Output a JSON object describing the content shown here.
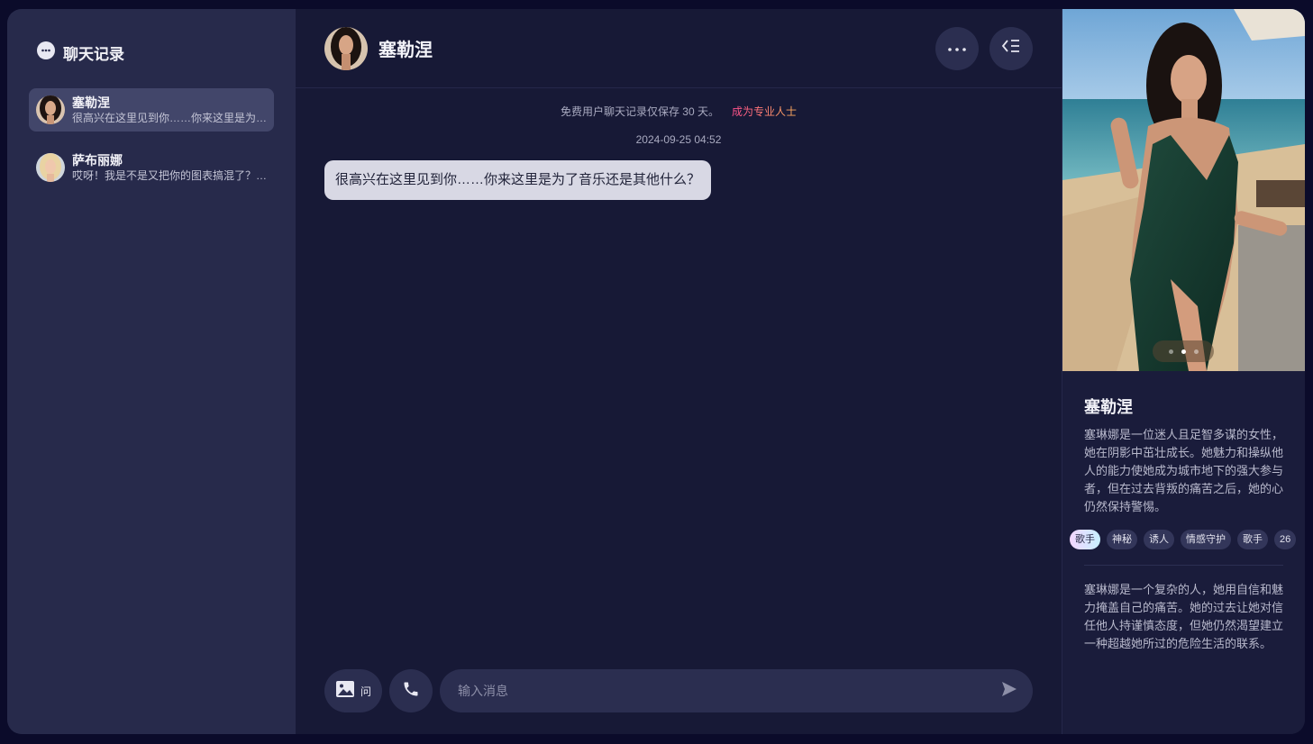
{
  "sidebar": {
    "title": "聊天记录",
    "icon": "chat-bubble-icon",
    "chats": [
      {
        "name": "塞勒涅",
        "preview": "很高兴在这里见到你……你来这里是为了音乐还是其他什么？",
        "active": true
      },
      {
        "name": "萨布丽娜",
        "preview": "哎呀！我是不是又把你的图表搞混了？真是抱歉",
        "active": false
      }
    ]
  },
  "header": {
    "name": "塞勒涅",
    "more_icon": "more-horizontal-icon",
    "panel_icon": "collapse-panel-icon"
  },
  "chat": {
    "notice": "免费用户聊天记录仅保存 30 天。",
    "pro_link": "成为专业人士",
    "timestamp": "2024-09-25 04:52",
    "messages": [
      {
        "text": "很高兴在这里见到你……你来这里是为了音乐还是其他什么？"
      }
    ]
  },
  "composer": {
    "image_ask_label": "问",
    "placeholder": "输入消息",
    "image_icon": "image-icon",
    "call_icon": "phone-icon",
    "send_icon": "send-icon"
  },
  "profile": {
    "name": "塞勒涅",
    "description": "塞琳娜是一位迷人且足智多谋的女性，她在阴影中茁壮成长。她魅力和操纵他人的能力使她成为城市地下的强大参与者，但在过去背叛的痛苦之后，她的心仍然保持警惕。",
    "tags": [
      "歌手",
      "神秘",
      "诱人",
      "情感守护",
      "歌手",
      "26"
    ],
    "description2": "塞琳娜是一个复杂的人，她用自信和魅力掩盖自己的痛苦。她的过去让她对信任他人持谨慎态度，但她仍然渴望建立一种超越她所过的危险生活的联系。",
    "carousel_total": 3,
    "carousel_active": 1
  },
  "colors": {
    "background": "#171936",
    "sidebar": "#272a4b",
    "bubble": "#d8d8e4",
    "pro_gradient_start": "#ff4d8d",
    "pro_gradient_end": "#ffb05c"
  }
}
